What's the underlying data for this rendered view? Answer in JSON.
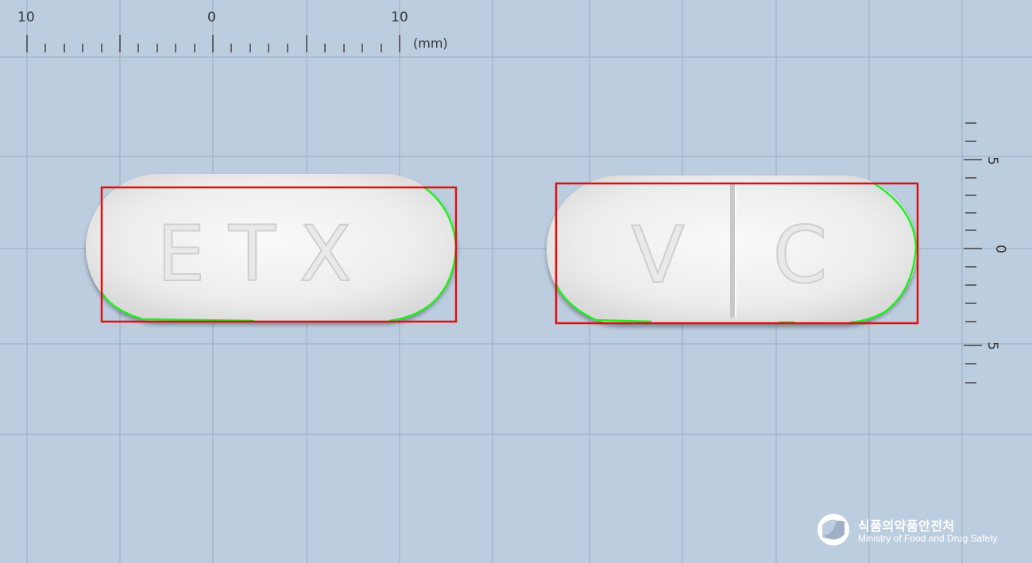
{
  "ruler": {
    "top_labels": [
      "10",
      "0",
      "10"
    ],
    "unit": "(mm)",
    "right_labels": [
      "5",
      "0",
      "5"
    ]
  },
  "tablets": [
    {
      "imprint": "ETX",
      "color": "#f2f2f2"
    },
    {
      "imprint_left": "V",
      "imprint_right": "C",
      "score_line": true,
      "color": "#f2f2f2"
    }
  ],
  "colors": {
    "background": "#bdcde0",
    "grid": "#9fb3cb",
    "bbox": "#e01010",
    "contour": "#22ee22",
    "tablet": "#f2f2f2"
  },
  "logo": {
    "icon": "mfds-emblem-icon",
    "korean": "식품의약품안전처",
    "english": "Ministry of Food and Drug Safety"
  }
}
